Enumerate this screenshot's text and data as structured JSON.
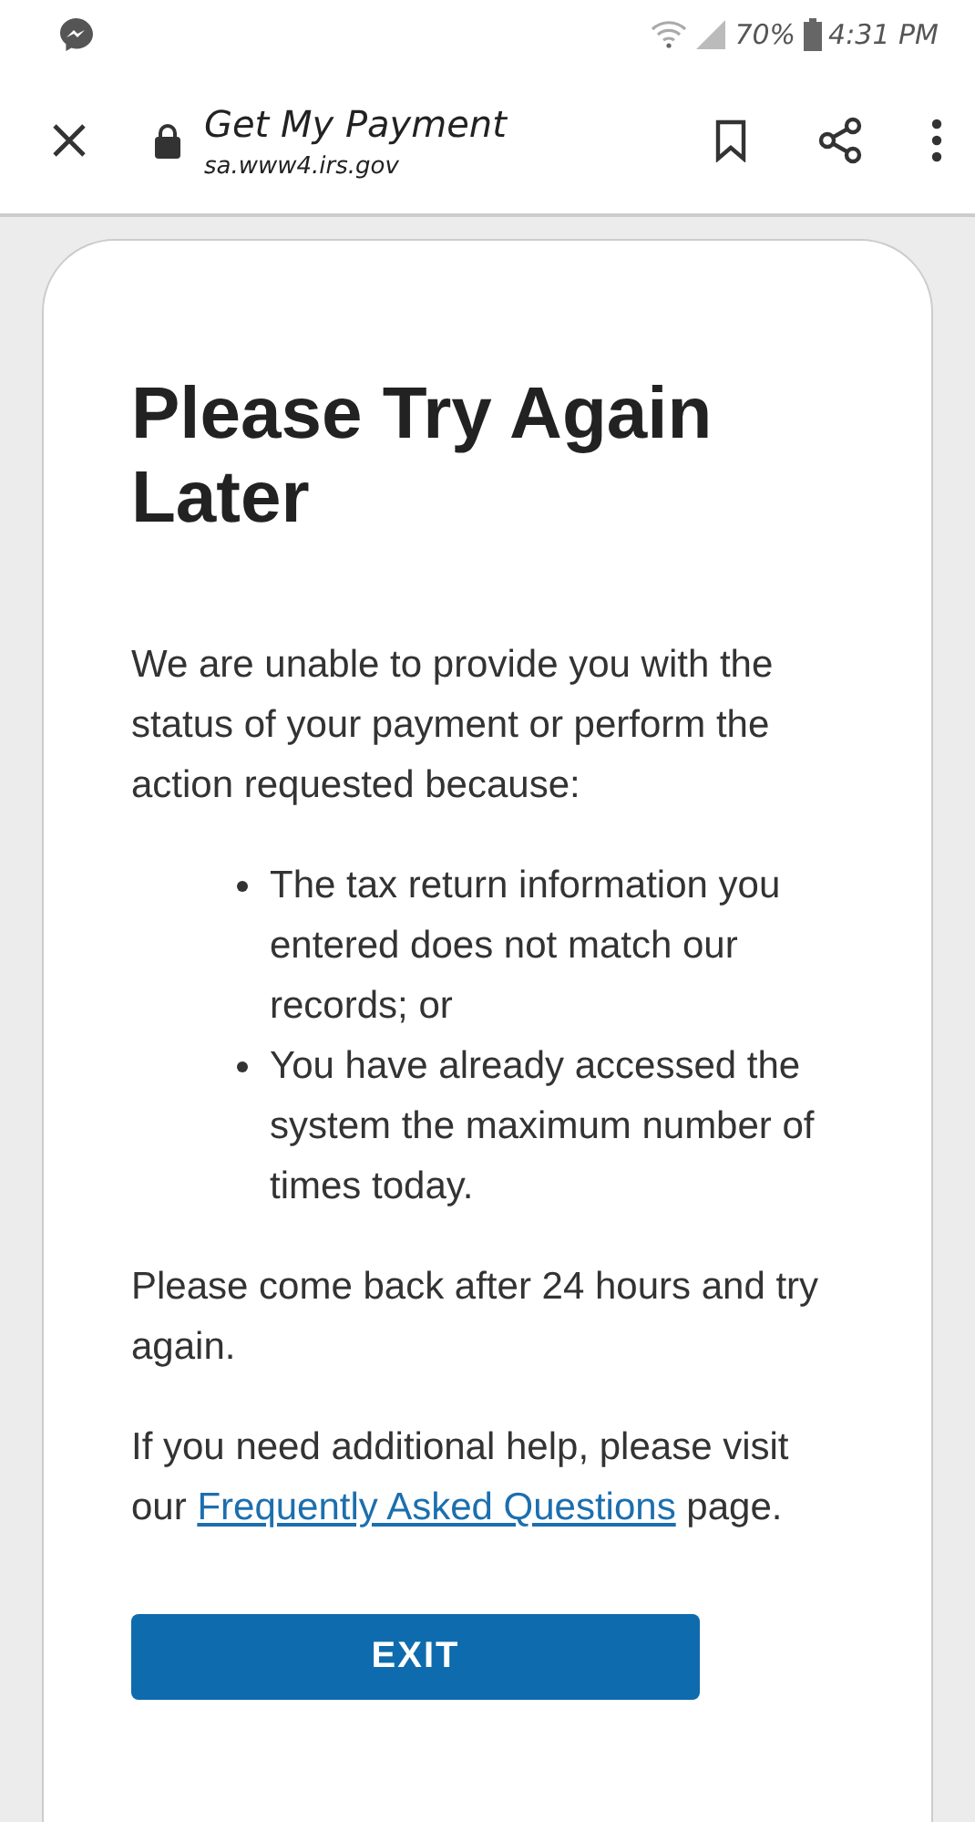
{
  "status_bar": {
    "battery": "70%",
    "time": "4:31 PM"
  },
  "toolbar": {
    "title": "Get My Payment",
    "url": "sa.www4.irs.gov"
  },
  "page": {
    "heading": "Please Try Again Later",
    "intro": "We are unable to provide you with the status of your payment or perform the action requested because:",
    "reasons": [
      "The tax return information you entered does not match our records; or",
      "You have already accessed the system the maximum number of times today."
    ],
    "retry": "Please come back after 24 hours and try again.",
    "help": {
      "before": "If you need additional help, please visit our",
      "link": "Frequently Asked Questions",
      "after": "page."
    },
    "button": "EXIT"
  }
}
